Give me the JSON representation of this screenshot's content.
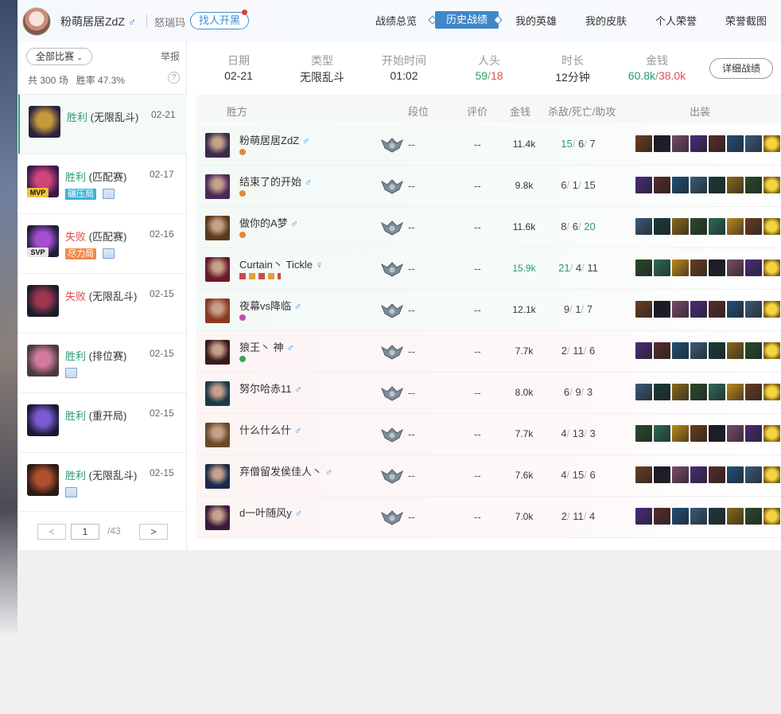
{
  "header": {
    "username": "粉萌居居ZdZ",
    "gender_symbol": "♂",
    "server": "怒瑞玛",
    "find_button": "找人开黑",
    "nav": [
      "战绩总览",
      "历史战绩",
      "我的英雄",
      "我的皮肤",
      "个人荣誉",
      "荣誉截图"
    ],
    "active_nav": "历史战绩"
  },
  "sidebar": {
    "filter": "全部比赛",
    "report": "举报",
    "summary_total": "共 300 场",
    "summary_winrate": "胜率 47.3%",
    "help": "?",
    "matches": [
      {
        "result": "胜利",
        "mode": "(无限乱斗)",
        "date": "02-21",
        "win": true,
        "selected": true
      },
      {
        "result": "胜利",
        "mode": "(匹配赛)",
        "date": "02-17",
        "win": true,
        "badge": "MVP",
        "tag": "碾压局",
        "tag_color": "#3db4d6"
      },
      {
        "result": "失败",
        "mode": "(匹配赛)",
        "date": "02-16",
        "win": false,
        "badge": "SVP",
        "tag": "尽力局",
        "tag_color": "#f08a4a"
      },
      {
        "result": "失败",
        "mode": "(无限乱斗)",
        "date": "02-15",
        "win": false
      },
      {
        "result": "胜利",
        "mode": "(排位赛)",
        "date": "02-15",
        "win": true
      },
      {
        "result": "胜利",
        "mode": "(重开局)",
        "date": "02-15",
        "win": true
      },
      {
        "result": "胜利",
        "mode": "(无限乱斗)",
        "date": "02-15",
        "win": true
      }
    ],
    "pager": {
      "prev": "<",
      "page": "1",
      "total": "/43",
      "next": ">"
    }
  },
  "summary": {
    "date_label": "日期",
    "date": "02-21",
    "type_label": "类型",
    "type": "无限乱斗",
    "start_label": "开始时间",
    "start": "01:02",
    "kills_label": "人头",
    "kills_a": "59",
    "kills_sep": "/",
    "kills_b": "18",
    "duration_label": "时长",
    "duration": "12分钟",
    "gold_label": "金钱",
    "gold_a": "60.8k",
    "gold_sep": "/",
    "gold_b": "38.0k",
    "detail_button": "详细战绩"
  },
  "table": {
    "headers": {
      "team": "胜方",
      "rank": "段位",
      "eval": "评价",
      "gold": "金钱",
      "kda": "杀敌/死亡/助攻",
      "items": "出装"
    },
    "rows": [
      {
        "name": "粉萌居居ZdZ",
        "gender": "♂",
        "rank": "--",
        "eval": "--",
        "gold": "11.4k",
        "k": "15",
        "d": "6",
        "a": "7",
        "win": true
      },
      {
        "name": "结束了的开始",
        "gender": "♂",
        "rank": "--",
        "eval": "--",
        "gold": "9.8k",
        "k": "6",
        "d": "1",
        "a": "15",
        "win": true
      },
      {
        "name": "做你的A梦",
        "gender": "♂",
        "rank": "--",
        "eval": "--",
        "gold": "11.6k",
        "k": "8",
        "d": "6",
        "a": "20",
        "win": true
      },
      {
        "name": "Curtain丶 Tickle",
        "gender": "♀",
        "rank": "--",
        "eval": "--",
        "gold": "15.9k",
        "k": "21",
        "d": "4",
        "a": "11",
        "win": true
      },
      {
        "name": "夜幕vs降临",
        "gender": "♂",
        "rank": "--",
        "eval": "--",
        "gold": "12.1k",
        "k": "9",
        "d": "1",
        "a": "7",
        "win": true
      },
      {
        "name": "狼王丶 神",
        "gender": "♂",
        "rank": "--",
        "eval": "--",
        "gold": "7.7k",
        "k": "2",
        "d": "11",
        "a": "6",
        "win": false
      },
      {
        "name": "努尔哈赤11",
        "gender": "♂",
        "rank": "--",
        "eval": "--",
        "gold": "8.0k",
        "k": "6",
        "d": "9",
        "a": "3",
        "win": false
      },
      {
        "name": "什么什么什",
        "gender": "♂",
        "rank": "--",
        "eval": "--",
        "gold": "7.7k",
        "k": "4",
        "d": "13",
        "a": "3",
        "win": false
      },
      {
        "name": "弃僧留发侯佳人丶",
        "gender": "♂",
        "rank": "--",
        "eval": "--",
        "gold": "7.6k",
        "k": "4",
        "d": "15",
        "a": "6",
        "win": false
      },
      {
        "name": "d一叶随风y",
        "gender": "♂",
        "rank": "--",
        "eval": "--",
        "gold": "7.0k",
        "k": "2",
        "d": "11",
        "a": "4",
        "win": false
      }
    ],
    "sep": "/"
  },
  "colors": {
    "win": "#2b9c6f",
    "loss": "#e14c4c",
    "accent": "#3f87c9"
  }
}
